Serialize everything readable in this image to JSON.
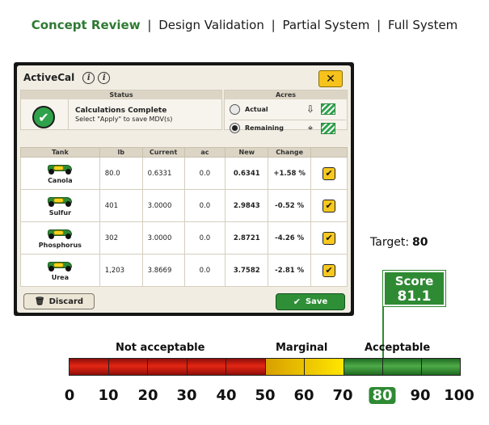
{
  "stages": {
    "active": "Concept Review",
    "items": [
      "Design Validation",
      "Partial System",
      "Full System"
    ],
    "separator": "|"
  },
  "app": {
    "title": "ActiveCal",
    "info_icons": [
      "i",
      "i"
    ],
    "close_label": "✕",
    "status": {
      "header": "Status",
      "title": "Calculations Complete",
      "subtitle": "Select \"Apply\" to save MDV(s)"
    },
    "acres": {
      "header": "Acres",
      "options": [
        {
          "label": "Actual",
          "selected": false,
          "icon": "download-arrow-icon"
        },
        {
          "label": "Remaining",
          "selected": true,
          "icon": "crosshair-icon"
        }
      ]
    },
    "table": {
      "headers": [
        "Tank",
        "lb",
        "Current",
        "ac",
        "New",
        "Change",
        ""
      ],
      "rows": [
        {
          "tank": "Canola",
          "lb": "80.0",
          "current": "0.6331",
          "ac": "0.0",
          "new": "0.6341",
          "change": "+1.58 %",
          "checked": true
        },
        {
          "tank": "Sulfur",
          "lb": "401",
          "current": "3.0000",
          "ac": "0.0",
          "new": "2.9843",
          "change": "-0.52 %",
          "checked": true
        },
        {
          "tank": "Phosphorus",
          "lb": "302",
          "current": "3.0000",
          "ac": "0.0",
          "new": "2.8721",
          "change": "-4.26 %",
          "checked": true
        },
        {
          "tank": "Urea",
          "lb": "1,203",
          "current": "3.8669",
          "ac": "0.0",
          "new": "3.7582",
          "change": "-2.81 %",
          "checked": true
        }
      ]
    },
    "buttons": {
      "discard": "Discard",
      "save": "Save"
    }
  },
  "evaluation": {
    "target_label": "Target:",
    "target_value": "80",
    "score_label": "Score",
    "score_value": "81.1",
    "zones": [
      "Not acceptable",
      "Marginal",
      "Acceptable"
    ],
    "scale_ticks": [
      "0",
      "10",
      "20",
      "30",
      "40",
      "50",
      "60",
      "70",
      "80",
      "90",
      "100"
    ],
    "marked_tick": "80",
    "colors": {
      "red": "#e52613",
      "yellow": "#ffe600",
      "green": "#2f8a34"
    }
  }
}
